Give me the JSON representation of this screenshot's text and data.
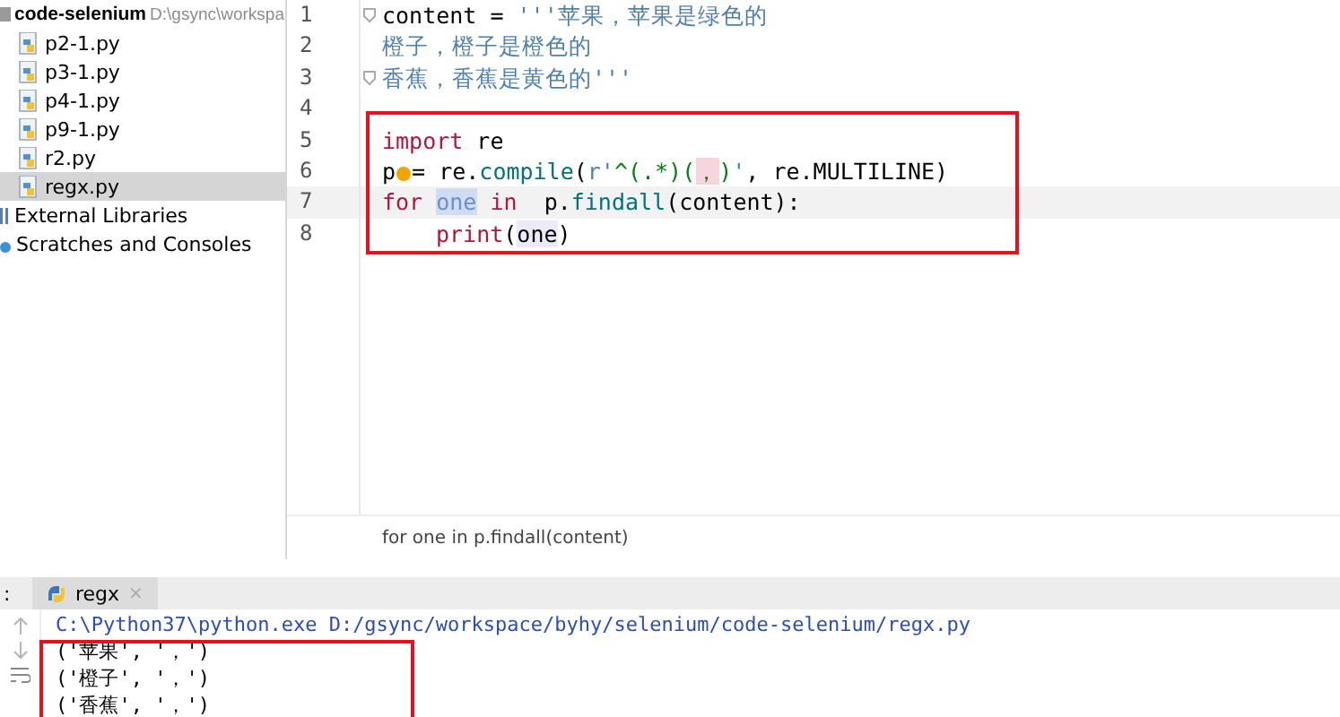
{
  "project": {
    "name": "code-selenium",
    "path": "D:\\gsync\\workspa",
    "files": [
      {
        "name": "p2-1.py",
        "selected": false
      },
      {
        "name": "p3-1.py",
        "selected": false
      },
      {
        "name": "p4-1.py",
        "selected": false
      },
      {
        "name": "p9-1.py",
        "selected": false
      },
      {
        "name": "r2.py",
        "selected": false
      },
      {
        "name": "regx.py",
        "selected": true
      }
    ],
    "other_items": [
      {
        "name": "External Libraries",
        "kind": "library"
      },
      {
        "name": "Scratches and Consoles",
        "kind": "scratch"
      }
    ]
  },
  "editor": {
    "lines": [
      {
        "number": "1",
        "current": false,
        "fold": true,
        "tokens": [
          {
            "text": "content = ",
            "kind": "plain"
          },
          {
            "text": "'''苹果，苹果是绿色的",
            "kind": "string"
          }
        ]
      },
      {
        "number": "2",
        "current": false,
        "fold": false,
        "tokens": [
          {
            "text": "橙子，橙子是橙色的",
            "kind": "string"
          }
        ]
      },
      {
        "number": "3",
        "current": false,
        "fold": true,
        "tokens": [
          {
            "text": "香蕉，香蕉是黄色的'''",
            "kind": "string"
          }
        ]
      },
      {
        "number": "4",
        "current": false,
        "fold": false
      },
      {
        "number": "5",
        "current": false,
        "fold": false,
        "tokens": [
          {
            "text": "import",
            "kind": "keyword"
          },
          {
            "text": " re",
            "kind": "plain"
          }
        ]
      },
      {
        "number": "6",
        "current": false,
        "fold": false,
        "tokens": [
          {
            "text": "p",
            "kind": "plain"
          },
          {
            "kind": "bulb"
          },
          {
            "text": "= re.",
            "kind": "plain"
          },
          {
            "text": "compile",
            "kind": "call"
          },
          {
            "text": "(",
            "kind": "plain"
          },
          {
            "text": "r'",
            "kind": "string"
          },
          {
            "text": "^(.*)(",
            "kind": "regex"
          },
          {
            "text": "，",
            "kind": "regex-hl"
          },
          {
            "text": ")",
            "kind": "regex"
          },
          {
            "text": "'",
            "kind": "string"
          },
          {
            "text": ", re.MULTILINE)",
            "kind": "plain"
          }
        ]
      },
      {
        "number": "7",
        "current": true,
        "fold": false,
        "tokens": [
          {
            "text": "for ",
            "kind": "keyword"
          },
          {
            "text": "one",
            "kind": "selected"
          },
          {
            "text": " in",
            "kind": "keyword"
          },
          {
            "text": "  p.",
            "kind": "plain"
          },
          {
            "text": "findall",
            "kind": "call"
          },
          {
            "text": "(content):",
            "kind": "plain"
          }
        ]
      },
      {
        "number": "8",
        "current": false,
        "fold": false,
        "indented": true,
        "tokens": [
          {
            "text": "print",
            "kind": "builtin"
          },
          {
            "text": "(",
            "kind": "plain"
          },
          {
            "text": "one",
            "kind": "usage"
          },
          {
            "text": ")",
            "kind": "plain"
          }
        ]
      }
    ],
    "breadcrumb": "for one in p.findall(content)"
  },
  "run_panel": {
    "prefix": ":",
    "tab": {
      "label": "regx",
      "close": "×"
    },
    "command": "C:\\Python37\\python.exe D:/gsync/workspace/byhy/selenium/code-selenium/regx.py",
    "output": [
      "('苹果', '，')",
      "('橙子', '，')",
      "('香蕉', '，')"
    ]
  }
}
